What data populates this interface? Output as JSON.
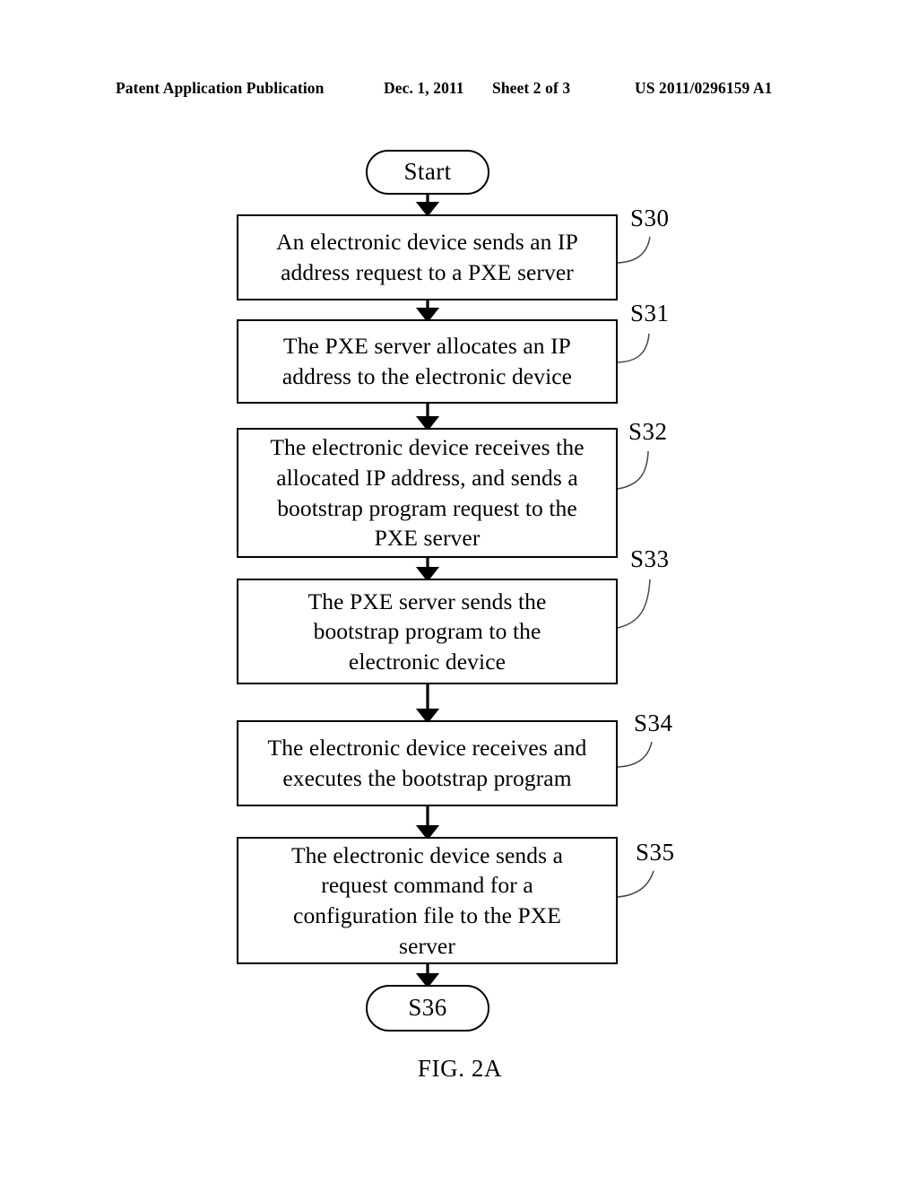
{
  "header": {
    "publication": "Patent Application Publication",
    "date": "Dec. 1, 2011",
    "sheet": "Sheet 2 of 3",
    "patent_number": "US 2011/0296159 A1"
  },
  "figure": {
    "caption": "FIG. 2A",
    "title": "Start"
  },
  "flowchart": {
    "start_label": "Start",
    "end_label": "S36",
    "steps": [
      {
        "ref": "S30",
        "lines": [
          "An electronic device sends an IP",
          "address request to a PXE server"
        ],
        "text": "An electronic device sends an IP address request to a PXE server"
      },
      {
        "ref": "S31",
        "lines": [
          "The PXE server allocates an IP",
          "address to the electronic device"
        ],
        "text": "The PXE server allocates an IP address to the electronic device"
      },
      {
        "ref": "S32",
        "lines": [
          "The electronic device receives the",
          "allocated IP address, and sends a",
          "bootstrap program request to the",
          "PXE server"
        ],
        "text": "The electronic device receives the allocated IP address, and sends a bootstrap program request to the PXE server"
      },
      {
        "ref": "S33",
        "lines": [
          "The PXE server sends the",
          "bootstrap program to the",
          "electronic device"
        ],
        "text": "The PXE server sends the bootstrap program to the electronic device"
      },
      {
        "ref": "S34",
        "lines": [
          "The electronic device receives and",
          "executes the bootstrap program"
        ],
        "text": "The electronic device receives and executes the bootstrap program"
      },
      {
        "ref": "S35",
        "lines": [
          "The electronic device sends a",
          "request command for a",
          "configuration file to the PXE",
          "server"
        ],
        "text": "The electronic device sends a request command for a configuration file to the PXE server"
      }
    ]
  },
  "colors": {
    "ink": "#000000",
    "paper": "#ffffff"
  }
}
